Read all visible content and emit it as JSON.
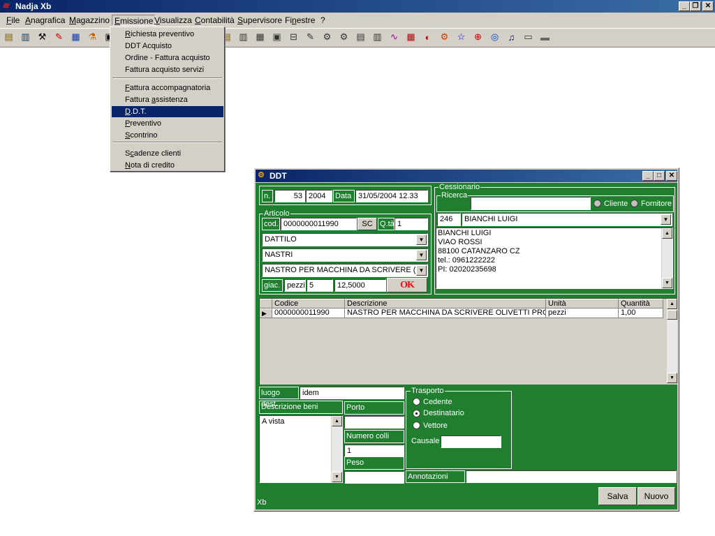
{
  "app": {
    "title": "Nadja Xb"
  },
  "menubar": [
    {
      "label": "File",
      "u": "F",
      "rest": "ile"
    },
    {
      "label": "Anagrafica",
      "u": "A",
      "rest": "nagrafica"
    },
    {
      "label": "Magazzino",
      "u": "M",
      "rest": "agazzino"
    },
    {
      "label": "Emissione",
      "u": "E",
      "rest": "missione"
    },
    {
      "label": "Visualizza",
      "u": "V",
      "rest": "isualizza"
    },
    {
      "label": "Contabilità",
      "u": "C",
      "rest": "ontabilità"
    },
    {
      "label": "Supervisore",
      "u": "S",
      "rest": "upervisore"
    },
    {
      "label": "Finestre",
      "pre": "Fi",
      "u": "n",
      "rest": "estre"
    },
    {
      "label": "?",
      "u": "",
      "rest": "?"
    }
  ],
  "emissione_menu": {
    "items": [
      {
        "pre": "",
        "u": "R",
        "rest": "ichiesta preventivo"
      },
      {
        "pre": "DDT Acquisto",
        "u": "",
        "rest": ""
      },
      {
        "pre": "Ordine - Fattura acquisto",
        "u": "",
        "rest": ""
      },
      {
        "pre": "Fattura acquisto servizi",
        "u": "",
        "rest": ""
      },
      {
        "pre": "",
        "u": "F",
        "rest": "attura accompagnatoria"
      },
      {
        "pre": "Fattura ",
        "u": "a",
        "rest": "ssistenza"
      },
      {
        "pre": "",
        "u": "D",
        "rest": ".D.T."
      },
      {
        "pre": "",
        "u": "P",
        "rest": "reventivo"
      },
      {
        "pre": "",
        "u": "S",
        "rest": "contrino"
      },
      {
        "pre": "S",
        "u": "c",
        "rest": "adenze clienti"
      },
      {
        "pre": "",
        "u": "N",
        "rest": "ota di credito"
      }
    ],
    "selected": "D.D.T."
  },
  "ddt": {
    "title": "DDT",
    "n_label": "n.",
    "number": "53",
    "year": "2004",
    "data_label": "Data",
    "date": "31/05/2004 12.33",
    "articolo_label": "Articolo",
    "cod_label": "cod.",
    "cod_value": "0000000011990",
    "sc_label": "SC",
    "qta_label": "Q.tà",
    "qta_value": "1",
    "combo1": "DATTILO",
    "combo2": "NASTRI",
    "combo3": "NASTRO PER MACCHINA DA SCRIVERE (",
    "giac_label": "giac.",
    "unit": "pezzi",
    "giac_value": "5",
    "price": "12,5000",
    "ok_label": "OK",
    "cessionario_label": "Cessionario",
    "ricerca_label": "Ricerca",
    "ricerca_value": "",
    "cliente_label": "Cliente",
    "fornitore_label": "Fornitore",
    "client_code": "246",
    "client_name": "BIANCHI LUIGI",
    "address_lines": [
      "BIANCHI LUIGI",
      "VIAO ROSSI",
      "88100 CATANZARO CZ",
      "tel.: 0961222222",
      "PI: 02020235698"
    ],
    "grid": {
      "headers": [
        "Codice",
        "Descrizione",
        "Unità",
        "Quantità"
      ],
      "rows": [
        [
          "0000000011990",
          "NASTRO PER MACCHINA DA SCRIVERE OLIVETTI PRO",
          "pezzi",
          "1,00"
        ]
      ]
    },
    "luogo_label": "luogo dest.",
    "luogo_value": "idem",
    "descrizione_beni_label": "Descrizione beni",
    "descrizione_beni_value": "A vista",
    "porto_label": "Porto",
    "porto_value": "",
    "numero_colli_label": "Numero colli",
    "numero_colli_value": "1",
    "peso_label": "Peso",
    "peso_value": "",
    "trasporto_label": "Trasporto",
    "cedente_label": "Cedente",
    "destinatario_label": "Destinatario",
    "vettore_label": "Vettore",
    "trasporto_selected": "Destinatario",
    "causale_label": "Causale",
    "causale_value": "",
    "annotazioni_label": "Annotazioni",
    "annotazioni_value": "",
    "footer_text": "Xb",
    "salva_label": "Salva",
    "nuovo_label": "Nuovo"
  },
  "colors": {
    "form_green": "#1f7f2f",
    "title_blue": "#0a246a",
    "menu_highlight": "#0a246a"
  }
}
